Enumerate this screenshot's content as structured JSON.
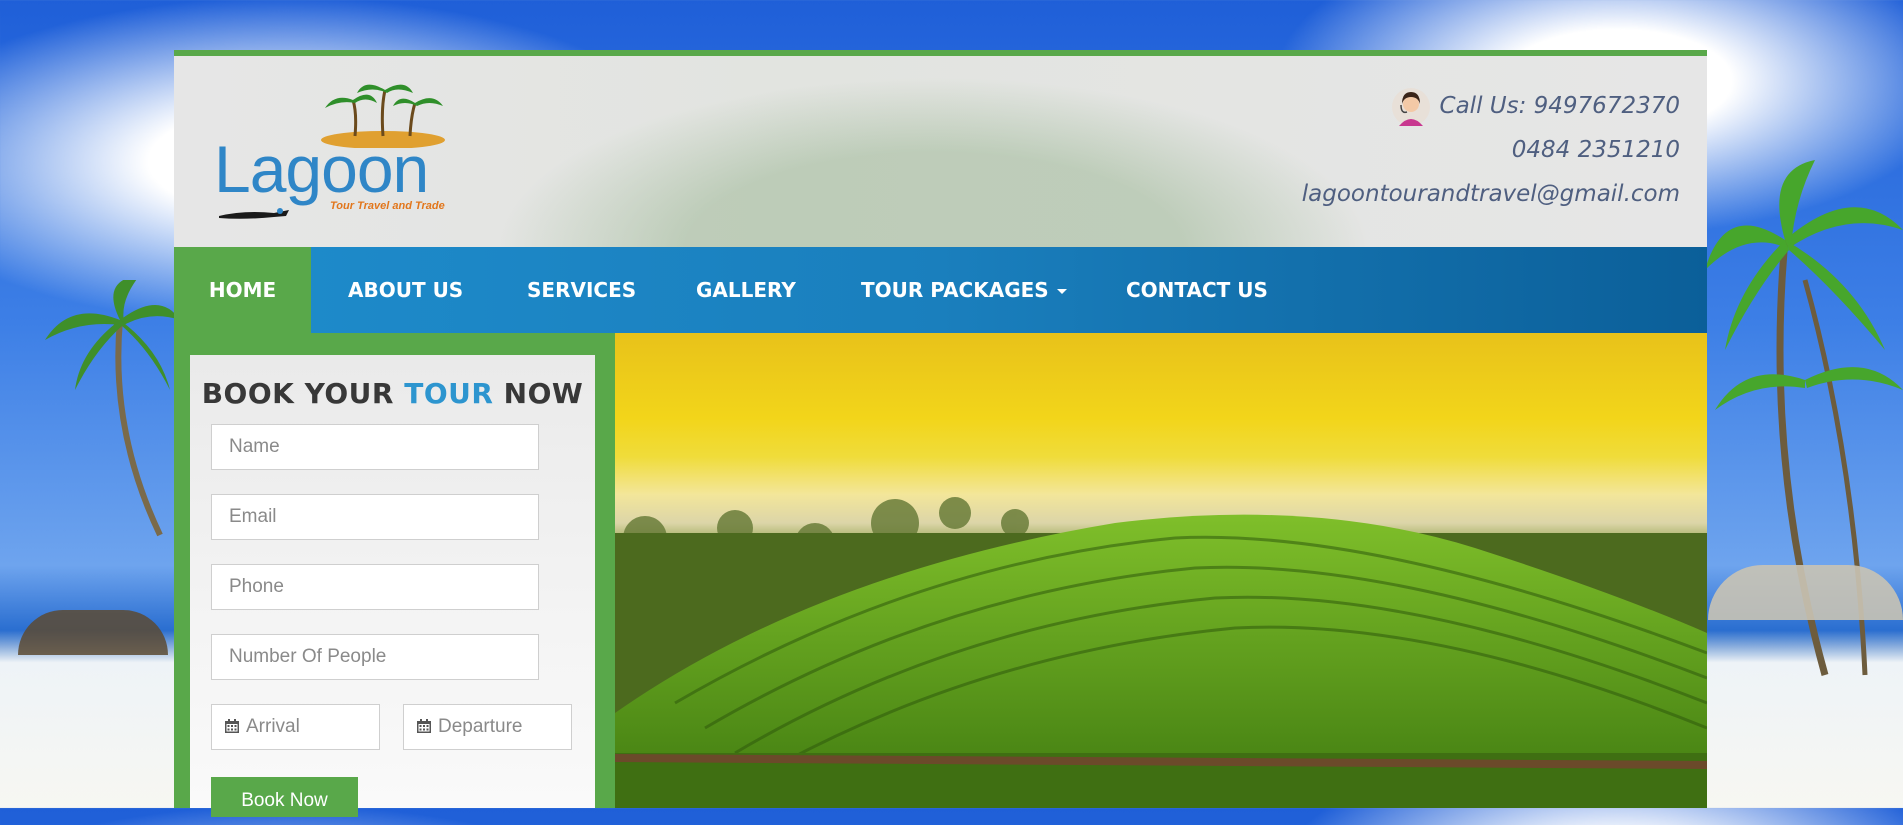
{
  "header": {
    "logo": {
      "name": "Lagoon",
      "tagline": "Tour Travel and Trade"
    },
    "contact": {
      "call_label": "Call Us: 9497672370",
      "phone2": "0484 2351210",
      "email": "lagoontourandtravel@gmail.com"
    }
  },
  "nav": {
    "items": [
      {
        "label": "HOME",
        "active": true
      },
      {
        "label": "ABOUT US"
      },
      {
        "label": "SERVICES"
      },
      {
        "label": "GALLERY"
      },
      {
        "label": "TOUR PACKAGES",
        "dropdown": true
      },
      {
        "label": "CONTACT US"
      }
    ]
  },
  "booking": {
    "title_part1": "BOOK YOUR ",
    "title_highlight": "TOUR",
    "title_part2": " NOW",
    "fields": {
      "name": "Name",
      "email": "Email",
      "phone": "Phone",
      "people": "Number Of People",
      "arrival": "Arrival",
      "departure": "Departure"
    },
    "submit_label": "Book Now"
  },
  "colors": {
    "brand_green": "#59a84a",
    "nav_blue": "#1e8ccc",
    "title_blue": "#2d95cf",
    "logo_blue": "#2f86c7",
    "logo_orange": "#e2761b"
  },
  "icons": [
    "support-agent-icon",
    "calendar-icon",
    "caret-down-icon",
    "palm-tree-icon",
    "snorkeler-icon"
  ]
}
